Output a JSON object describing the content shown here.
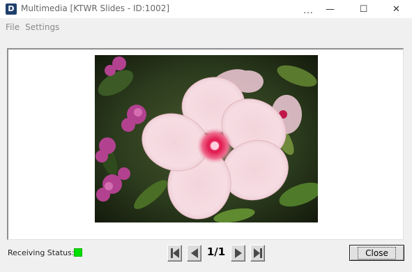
{
  "window": {
    "icon_letter": "D",
    "title": "Multimedia [KTWR Slides - ID:1002]",
    "more_label": "...",
    "minimize_glyph": "—",
    "maximize_glyph": "☐",
    "close_glyph": "✕"
  },
  "menu": {
    "items": [
      {
        "label": "File"
      },
      {
        "label": "Settings"
      }
    ]
  },
  "slide": {
    "image_subject": "pink-periwinkle-flower-photo"
  },
  "status": {
    "label": "Receiving Status:",
    "indicator_color": "#00e000"
  },
  "navigation": {
    "page_indicator": "1/1"
  },
  "footer": {
    "close_label": "Close"
  }
}
